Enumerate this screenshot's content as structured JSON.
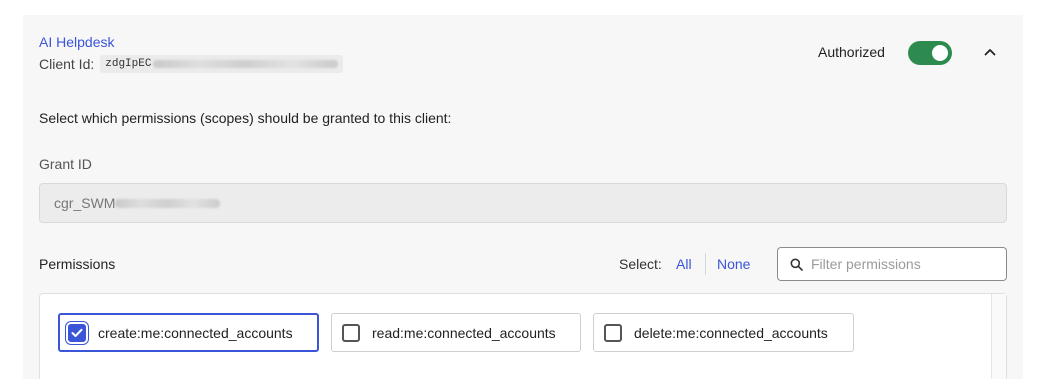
{
  "app": {
    "name": "AI Helpdesk",
    "client_id_label": "Client Id:",
    "client_id_value": "zdgIpEC"
  },
  "authorization": {
    "label": "Authorized",
    "enabled": true
  },
  "instructions": "Select which permissions (scopes) should be granted to this client:",
  "grant": {
    "label": "Grant ID",
    "value": "cgr_SWM"
  },
  "permissions": {
    "title": "Permissions",
    "select_label": "Select:",
    "select_all": "All",
    "select_none": "None",
    "filter_placeholder": "Filter permissions",
    "items": [
      {
        "label": "create:me:connected_accounts",
        "checked": true
      },
      {
        "label": "read:me:connected_accounts",
        "checked": false
      },
      {
        "label": "delete:me:connected_accounts",
        "checked": false
      }
    ]
  },
  "colors": {
    "accent": "#3b55d9",
    "toggle_on": "#2e8b4f",
    "card_bg": "#f7f7f7"
  },
  "icons": {
    "collapse": "chevron-up-icon",
    "filter": "search-icon",
    "checkbox": "checkmark-icon"
  }
}
